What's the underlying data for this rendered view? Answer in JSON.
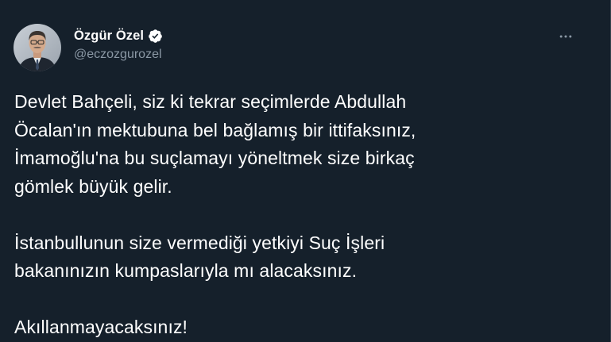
{
  "tweet": {
    "author": {
      "display_name": "Özgür Özel",
      "handle": "@eczozgurozel",
      "verified": true
    },
    "more_menu_icon": "more-horizontal-icon",
    "verified_icon": "verified-badge-icon",
    "paragraphs": [
      {
        "lines": [
          "Devlet Bahçeli, siz ki tekrar seçimlerde Abdullah",
          "Öcalan'ın mektubuna bel bağlamış bir ittifaksınız,",
          "İmamoğlu'na bu suçlamayı yöneltmek size birkaç",
          "gömlek büyük gelir."
        ]
      },
      {
        "lines": [
          "İstanbullunun size vermediği yetkiyi Suç İşleri",
          "bakanınızın kumpaslarıyla mı alacaksınız."
        ]
      },
      {
        "lines": [
          "Akıllanmayacaksınız!"
        ]
      }
    ]
  },
  "colors": {
    "background": "#15202b",
    "text_primary": "#ffffff",
    "text_secondary": "#8b98a5",
    "verified_badge": "#ffffff"
  }
}
